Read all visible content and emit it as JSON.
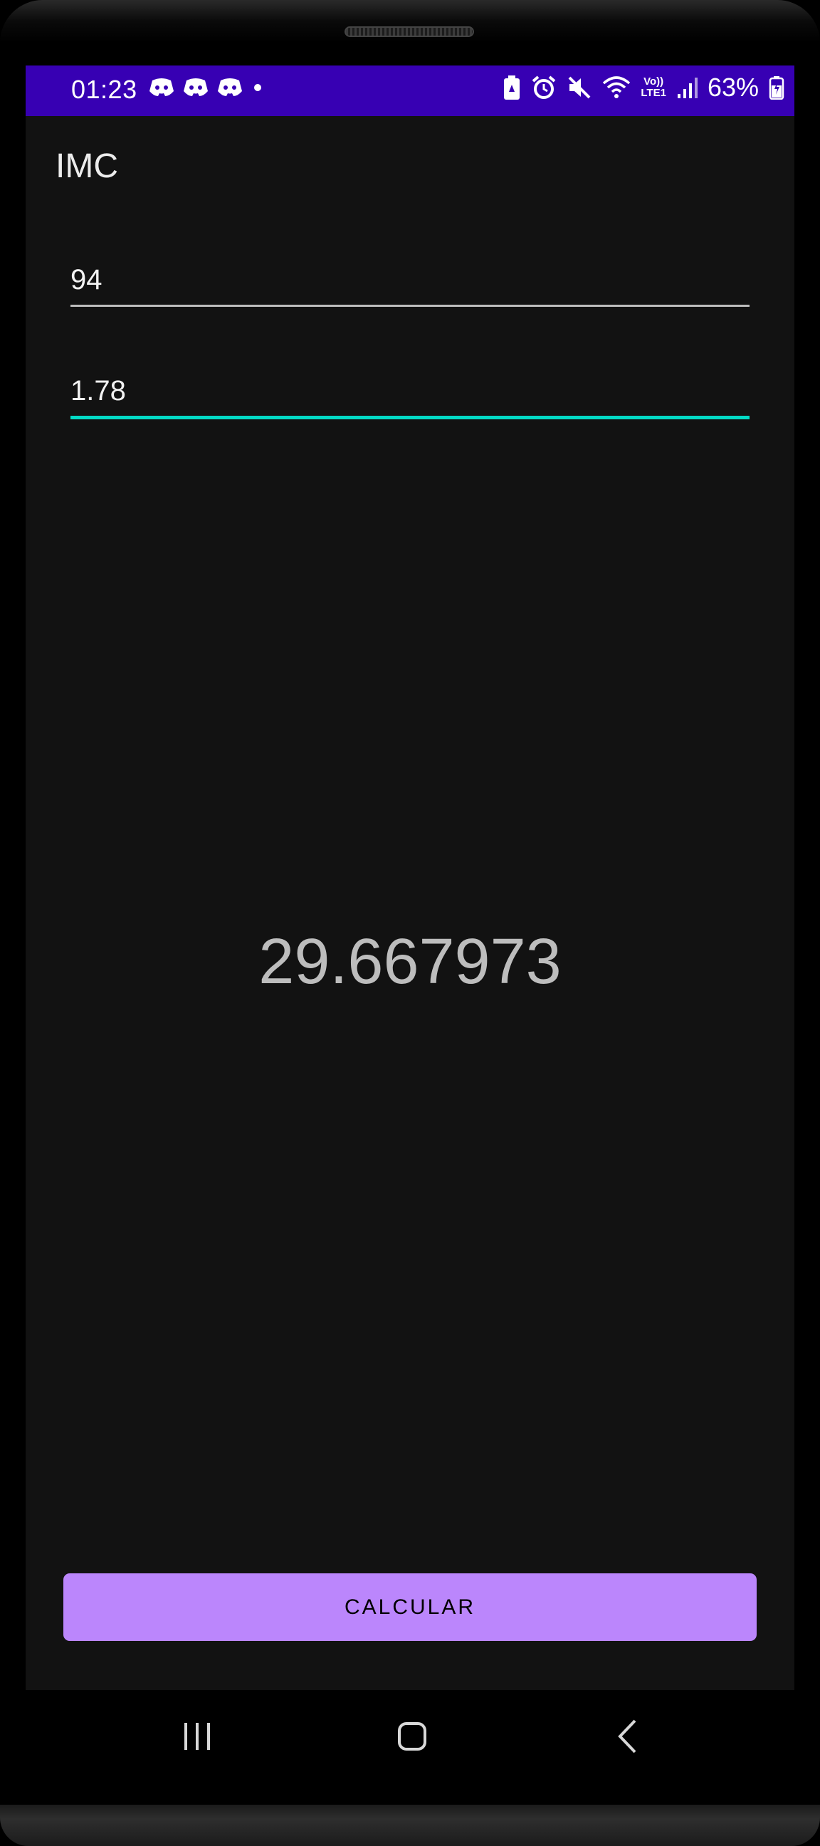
{
  "status_bar": {
    "time": "01:23",
    "battery_percent": "63%",
    "network_label_top": "Vo))",
    "network_label_bottom": "LTE1",
    "background_color": "#3700b3",
    "icons": [
      "discord-icon",
      "discord-icon",
      "discord-icon",
      "notification-dot-icon",
      "battery-saver-icon",
      "alarm-icon",
      "mute-icon",
      "wifi-icon",
      "signal-icon",
      "battery-icon"
    ]
  },
  "app": {
    "title": "IMC"
  },
  "form": {
    "weight_value": "94",
    "height_value": "1.78",
    "focused_underline_color": "#03dac5"
  },
  "result": {
    "value": "29.667973"
  },
  "button": {
    "label": "CALCULAR",
    "color": "#bb86fc"
  },
  "nav_bar": {
    "icons": [
      "recents-icon",
      "home-icon",
      "back-icon"
    ]
  }
}
